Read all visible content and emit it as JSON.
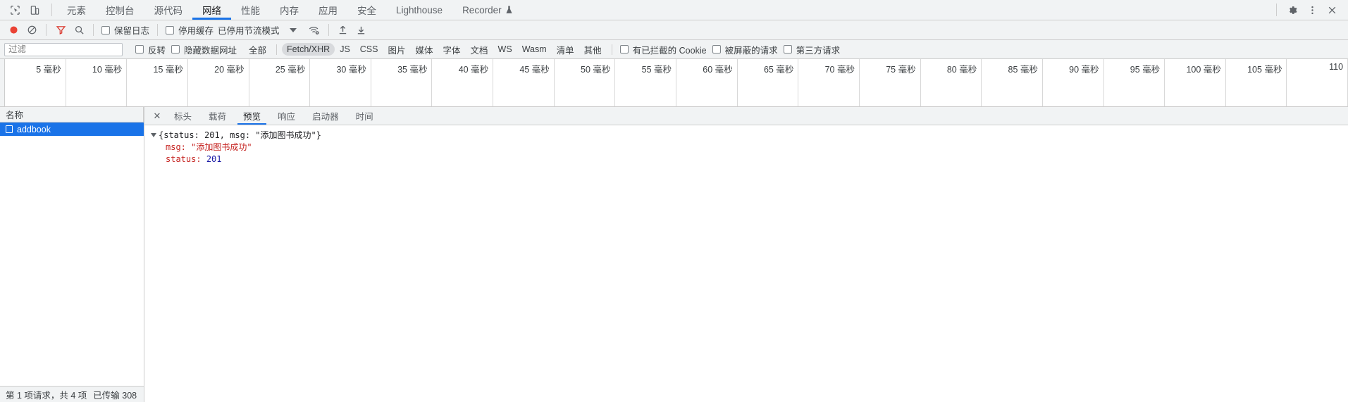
{
  "devtools": {
    "icons": {
      "inspect": "inspect-element-icon",
      "device": "device-toolbar-icon",
      "settings": "gear-icon",
      "more": "more-options-icon",
      "close": "close-icon"
    },
    "tabs": [
      {
        "label": "元素",
        "name": "elements"
      },
      {
        "label": "控制台",
        "name": "console"
      },
      {
        "label": "源代码",
        "name": "sources"
      },
      {
        "label": "网络",
        "name": "network"
      },
      {
        "label": "性能",
        "name": "performance"
      },
      {
        "label": "内存",
        "name": "memory"
      },
      {
        "label": "应用",
        "name": "application"
      },
      {
        "label": "安全",
        "name": "security"
      },
      {
        "label": "Lighthouse",
        "name": "lighthouse"
      },
      {
        "label": "Recorder",
        "name": "recorder"
      }
    ],
    "active_tab": "网络"
  },
  "network_toolbar": {
    "record_title": "record-button",
    "clear_title": "clear-button",
    "filter_title": "filter-button",
    "search_title": "search-button",
    "preserve_log": "保留日志",
    "disable_cache": "停用缓存",
    "throttling": "已停用节流模式",
    "wifi_title": "network-conditions-icon",
    "import_title": "import-har-icon",
    "export_title": "export-har-icon"
  },
  "filter_bar": {
    "placeholder": "过滤",
    "value": "",
    "invert": "反转",
    "hide_data_urls": "隐藏数据网址",
    "types": [
      {
        "label": "全部",
        "selected": false
      },
      {
        "label": "Fetch/XHR",
        "selected": true
      },
      {
        "label": "JS",
        "selected": false
      },
      {
        "label": "CSS",
        "selected": false
      },
      {
        "label": "图片",
        "selected": false
      },
      {
        "label": "媒体",
        "selected": false
      },
      {
        "label": "字体",
        "selected": false
      },
      {
        "label": "文档",
        "selected": false
      },
      {
        "label": "WS",
        "selected": false
      },
      {
        "label": "Wasm",
        "selected": false
      },
      {
        "label": "清单",
        "selected": false
      },
      {
        "label": "其他",
        "selected": false
      }
    ],
    "blocked_cookies": "有已拦截的 Cookie",
    "blocked_requests": "被屏蔽的请求",
    "third_party": "第三方请求"
  },
  "timeline": {
    "ticks": [
      "5 毫秒",
      "10 毫秒",
      "15 毫秒",
      "20 毫秒",
      "25 毫秒",
      "30 毫秒",
      "35 毫秒",
      "40 毫秒",
      "45 毫秒",
      "50 毫秒",
      "55 毫秒",
      "60 毫秒",
      "65 毫秒",
      "70 毫秒",
      "75 毫秒",
      "80 毫秒",
      "85 毫秒",
      "90 毫秒",
      "95 毫秒",
      "100 毫秒",
      "105 毫秒",
      "110"
    ]
  },
  "request_panel": {
    "column_header": "名称",
    "rows": [
      {
        "name": "addbook",
        "icon": "document-icon",
        "selected": true
      }
    ],
    "footer": {
      "requests": "第 1 项请求，共 4 项",
      "transferred": "已传输 308"
    }
  },
  "detail_panel": {
    "close_icon": "✕",
    "tabs": [
      {
        "label": "标头",
        "name": "headers"
      },
      {
        "label": "载荷",
        "name": "payload"
      },
      {
        "label": "预览",
        "name": "preview"
      },
      {
        "label": "响应",
        "name": "response"
      },
      {
        "label": "启动器",
        "name": "initiator"
      },
      {
        "label": "时间",
        "name": "timing"
      }
    ],
    "active_tab": "预览",
    "preview": {
      "root_summary": "{status: 201, msg: \"添加图书成功\"}",
      "entries": [
        {
          "key": "msg:",
          "value": "\"添加图书成功\"",
          "kind": "string"
        },
        {
          "key": "status:",
          "value": "201",
          "kind": "number"
        }
      ]
    }
  },
  "colors": {
    "accent": "#1a73e8",
    "toolbar_bg": "#f1f3f4",
    "record_red": "#ea4335",
    "filter_red": "#d93025",
    "string_red": "#c5221f",
    "number_blue": "#1a1aa6"
  }
}
